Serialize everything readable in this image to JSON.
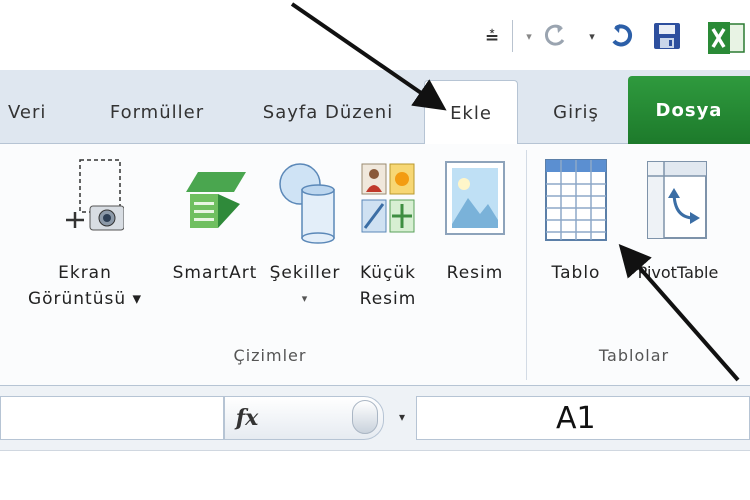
{
  "quick_access": {
    "customize_glyph": "⩮",
    "dropdown_glyph": "▾",
    "icons": [
      "customize-qat-icon",
      "undo-icon",
      "redo-icon",
      "save-icon",
      "excel-app-icon"
    ]
  },
  "tabs": [
    {
      "label": "Veri"
    },
    {
      "label": "Formüller"
    },
    {
      "label": "Sayfa Düzeni"
    },
    {
      "label": "Ekle",
      "active": true
    },
    {
      "label": "Giriş"
    },
    {
      "label": "Dosya",
      "accent": "#1f7f2e"
    }
  ],
  "ribbon": {
    "groups": [
      {
        "label": "Çizimler",
        "buttons": [
          {
            "label": [
              "Ekran",
              "Görüntüsü ▾"
            ],
            "icon": "screenshot-icon"
          },
          {
            "label": [
              "SmartArt"
            ],
            "icon": "smartart-icon"
          },
          {
            "label": [
              "Şekiller",
              "▾"
            ],
            "icon": "shapes-icon"
          },
          {
            "label": [
              "Küçük",
              "Resim"
            ],
            "icon": "clip-art-icon"
          },
          {
            "label": [
              "Resim"
            ],
            "icon": "picture-icon"
          }
        ]
      },
      {
        "label": "Tablolar",
        "buttons": [
          {
            "label": [
              "Tablo"
            ],
            "icon": "table-icon"
          },
          {
            "label": [
              "PivotTable"
            ],
            "icon": "pivottable-icon"
          }
        ]
      }
    ]
  },
  "formula_bar": {
    "fx_label": "fx",
    "name_box_value": "A1",
    "dropdown_glyph": "▾"
  },
  "colors": {
    "tab_bar": "#dfe7f0",
    "file_tab": "#1f7f2e",
    "ribbon_bg": "#fbfcfd"
  }
}
